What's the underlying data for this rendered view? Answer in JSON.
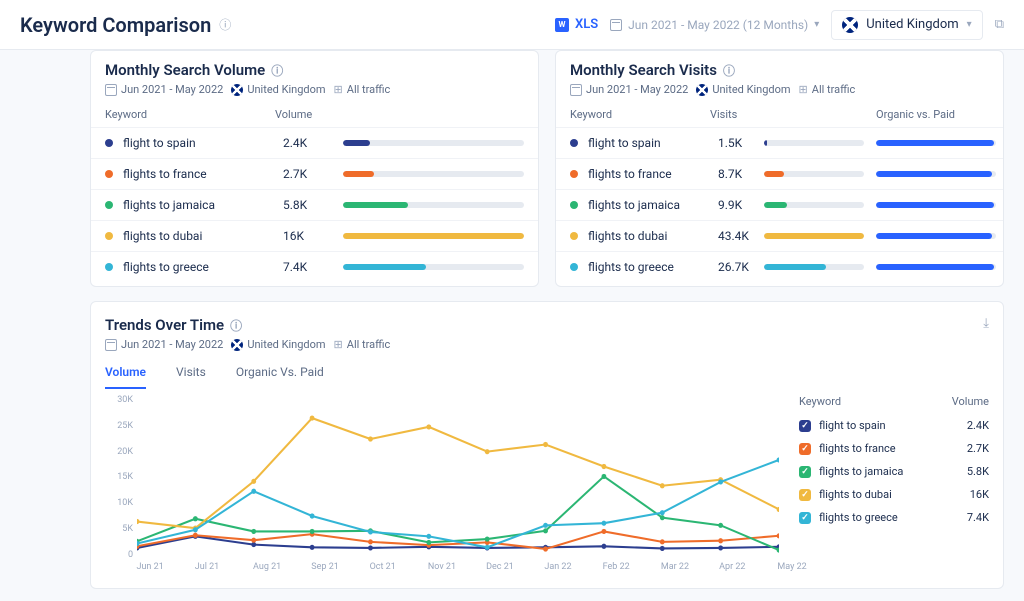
{
  "header": {
    "title": "Keyword Comparison",
    "xls_label": "XLS",
    "date_range_label": "Jun 2021 - May 2022 (12 Months)",
    "country_label": "United Kingdom"
  },
  "meta": {
    "date_range": "Jun 2021 - May 2022",
    "country": "United Kingdom",
    "traffic": "All traffic"
  },
  "colors": {
    "spain": "#2c3e8f",
    "france": "#ef6c2a",
    "jamaica": "#2bb673",
    "dubai": "#f0b940",
    "greece": "#33b5d6",
    "organic": "#2962ff"
  },
  "volume_card": {
    "title": "Monthly Search Volume",
    "col_kw": "Keyword",
    "col_val": "Volume",
    "rows": [
      {
        "kw": "flight to spain",
        "val": "2.4K",
        "pct": 15,
        "color": "spain"
      },
      {
        "kw": "flights to france",
        "val": "2.7K",
        "pct": 17,
        "color": "france"
      },
      {
        "kw": "flights to jamaica",
        "val": "5.8K",
        "pct": 36,
        "color": "jamaica"
      },
      {
        "kw": "flights to dubai",
        "val": "16K",
        "pct": 100,
        "color": "dubai"
      },
      {
        "kw": "flights to greece",
        "val": "7.4K",
        "pct": 46,
        "color": "greece"
      }
    ]
  },
  "visits_card": {
    "title": "Monthly Search Visits",
    "col_kw": "Keyword",
    "col_val": "Visits",
    "col_ovp": "Organic vs. Paid",
    "rows": [
      {
        "kw": "flight to spain",
        "val": "1.5K",
        "pct": 3,
        "ovp": 98,
        "color": "spain"
      },
      {
        "kw": "flights to france",
        "val": "8.7K",
        "pct": 20,
        "ovp": 97,
        "color": "france"
      },
      {
        "kw": "flights to jamaica",
        "val": "9.9K",
        "pct": 23,
        "ovp": 98,
        "color": "jamaica"
      },
      {
        "kw": "flights to dubai",
        "val": "43.4K",
        "pct": 100,
        "ovp": 97,
        "color": "dubai"
      },
      {
        "kw": "flights to greece",
        "val": "26.7K",
        "pct": 62,
        "ovp": 98,
        "color": "greece"
      }
    ]
  },
  "trends": {
    "title": "Trends Over Time",
    "tabs": [
      "Volume",
      "Visits",
      "Organic Vs. Paid"
    ],
    "active_tab": 0,
    "legend_kw": "Keyword",
    "legend_val": "Volume",
    "legend": [
      {
        "kw": "flight to spain",
        "val": "2.4K",
        "color": "spain"
      },
      {
        "kw": "flights to france",
        "val": "2.7K",
        "color": "france"
      },
      {
        "kw": "flights to jamaica",
        "val": "5.8K",
        "color": "jamaica"
      },
      {
        "kw": "flights to dubai",
        "val": "16K",
        "color": "dubai"
      },
      {
        "kw": "flights to greece",
        "val": "7.4K",
        "color": "greece"
      }
    ]
  },
  "chart_data": {
    "type": "line",
    "title": "Trends Over Time — Volume",
    "xlabel": "",
    "ylabel": "",
    "ylim": [
      0,
      30000
    ],
    "y_ticks": [
      "30K",
      "25K",
      "20K",
      "15K",
      "10K",
      "5K",
      "0"
    ],
    "categories": [
      "Jun 21",
      "Jul 21",
      "Aug 21",
      "Sep 21",
      "Oct 21",
      "Nov 21",
      "Dec 21",
      "Jan 22",
      "Feb 22",
      "Mar 22",
      "Apr 22",
      "May 22"
    ],
    "series": [
      {
        "name": "flight to spain",
        "color": "spain",
        "values": [
          2200,
          4300,
          2800,
          2300,
          2200,
          2400,
          2200,
          2300,
          2500,
          2100,
          2200,
          2400
        ]
      },
      {
        "name": "flights to france",
        "color": "france",
        "values": [
          2500,
          4500,
          3600,
          4700,
          3300,
          2700,
          3200,
          2000,
          5200,
          3300,
          3500,
          4400
        ]
      },
      {
        "name": "flights to jamaica",
        "color": "jamaica",
        "values": [
          3400,
          7500,
          5200,
          5200,
          5300,
          3200,
          3800,
          5300,
          15200,
          7700,
          6300,
          1800
        ]
      },
      {
        "name": "flights to dubai",
        "color": "dubai",
        "values": [
          7000,
          5800,
          14300,
          25800,
          22000,
          24200,
          19700,
          21000,
          17000,
          13500,
          14600,
          9200
        ]
      },
      {
        "name": "flights to greece",
        "color": "greece",
        "values": [
          3000,
          5500,
          12500,
          8000,
          5100,
          4300,
          2300,
          6300,
          6700,
          8600,
          14200,
          18200
        ]
      }
    ]
  }
}
